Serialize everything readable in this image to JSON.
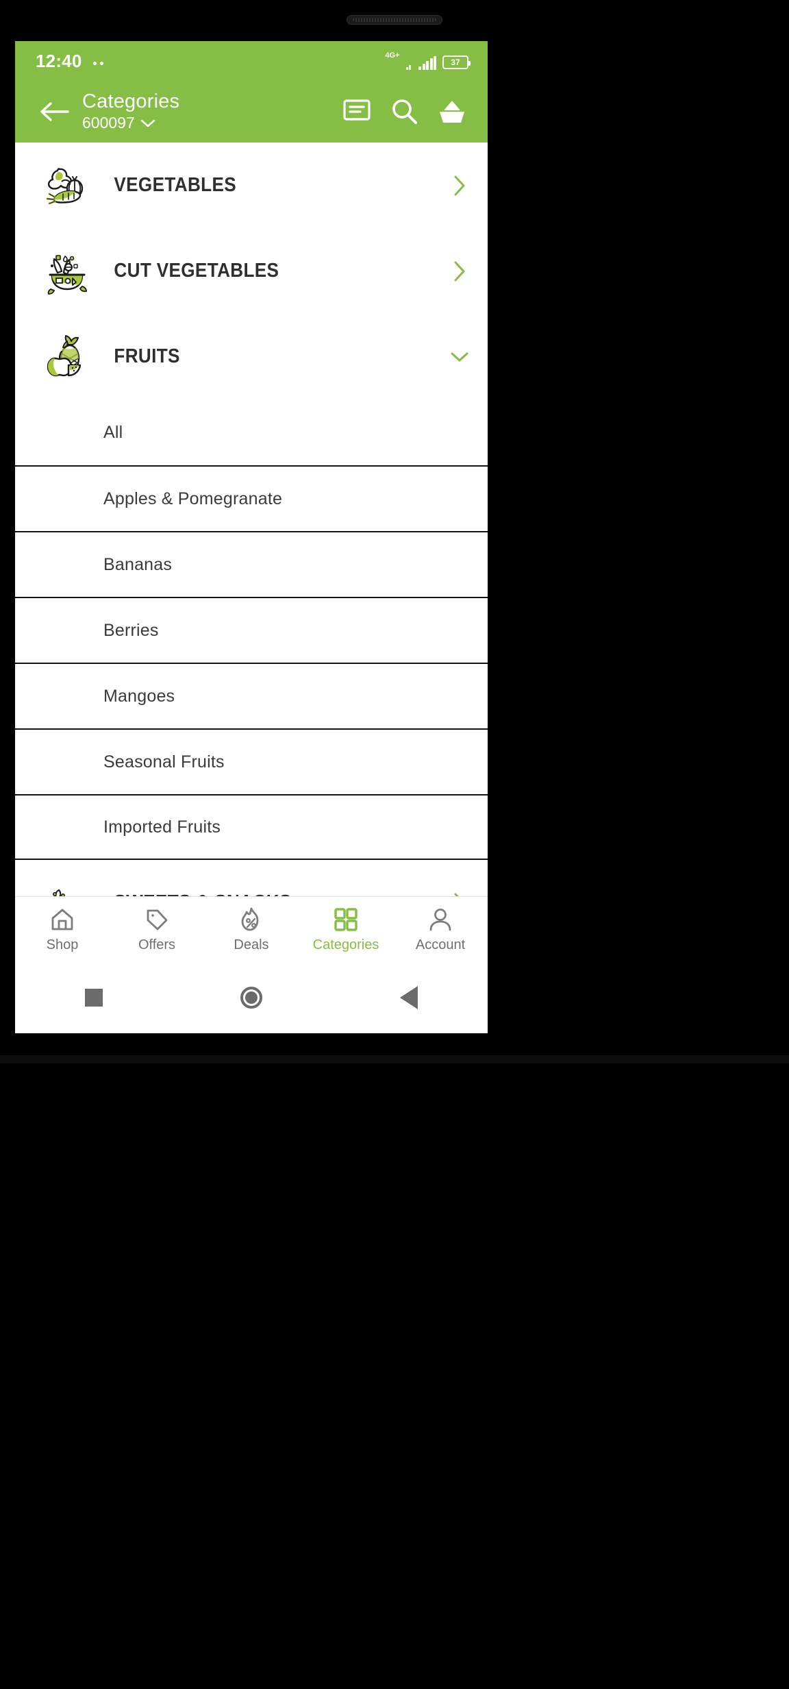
{
  "status_bar": {
    "time": "12:40",
    "network_label": "4G+",
    "battery_percent": "37"
  },
  "app_bar": {
    "title": "Categories",
    "pincode": "600097",
    "back_icon": "arrow-left-icon",
    "actions": [
      {
        "name": "chat-icon",
        "label": "Chat"
      },
      {
        "name": "search-icon",
        "label": "Search"
      },
      {
        "name": "basket-icon",
        "label": "Basket"
      }
    ]
  },
  "categories": [
    {
      "label": "VEGETABLES",
      "icon": "vegetables-icon",
      "expanded": false,
      "chevron": "chevron-right-icon",
      "subitems": []
    },
    {
      "label": "CUT VEGETABLES",
      "icon": "cut-vegetables-icon",
      "expanded": false,
      "chevron": "chevron-right-icon",
      "subitems": []
    },
    {
      "label": "FRUITS",
      "icon": "fruits-icon",
      "expanded": true,
      "chevron": "chevron-down-icon",
      "subitems": [
        "All",
        "Apples & Pomegranate",
        "Bananas",
        "Berries",
        "Mangoes",
        "Seasonal Fruits",
        "Imported Fruits"
      ]
    },
    {
      "label": "SWEETS & SNACKS",
      "icon": "sweets-snacks-icon",
      "expanded": false,
      "chevron": "chevron-right-icon",
      "subitems": []
    }
  ],
  "bottom_nav": {
    "active_index": 3,
    "items": [
      {
        "label": "Shop",
        "icon": "home-icon"
      },
      {
        "label": "Offers",
        "icon": "tag-icon"
      },
      {
        "label": "Deals",
        "icon": "flame-percent-icon"
      },
      {
        "label": "Categories",
        "icon": "grid-icon"
      },
      {
        "label": "Account",
        "icon": "person-icon"
      }
    ]
  },
  "system_nav": {
    "items": [
      {
        "name": "recent-apps-button"
      },
      {
        "name": "home-button"
      },
      {
        "name": "back-button"
      }
    ]
  },
  "colors": {
    "brand_green": "#86bd45",
    "icon_green": "#a9c83a",
    "text_dark": "#2f2f2f",
    "divider": "#141414"
  }
}
